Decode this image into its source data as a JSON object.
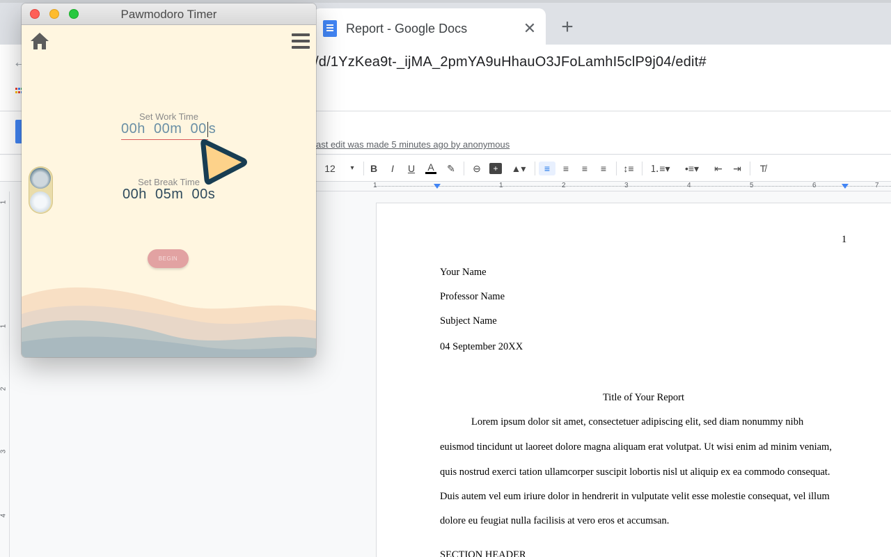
{
  "browser": {
    "tab_title": "Report - Google Docs",
    "tab_close": "✕",
    "new_tab": "+",
    "url": "/d/1YzKea9t-_ijMA_2pmYA9uHhauO3JFoLamhI5clP9j04/edit#",
    "back_arrow": "←"
  },
  "docs": {
    "last_edit": "ast edit was made 5 minutes ago by anonymous",
    "toolbar": {
      "font_size": "12",
      "bold": "B",
      "italic": "I",
      "underline": "U",
      "text_color": "A"
    },
    "ruler_numbers": [
      "1",
      "1",
      "2",
      "3",
      "4",
      "5",
      "6",
      "7"
    ],
    "vruler_numbers": [
      "1",
      "1",
      "2",
      "3",
      "4"
    ],
    "page": {
      "page_number": "1",
      "your_name": "Your Name",
      "professor_name": "Professor Name",
      "subject_name": "Subject Name",
      "date": "04 September 20XX",
      "title": "Title of Your Report",
      "body_lines": [
        "Lorem ipsum dolor sit amet, consectetuer adipiscing elit, sed diam nonummy nibh",
        "euismod tincidunt ut laoreet dolore magna aliquam erat volutpat. Ut wisi enim ad minim veniam,",
        "quis nostrud exerci tation ullamcorper suscipit lobortis nisl ut aliquip ex ea commodo consequat.",
        "Duis autem vel eum iriure dolor in hendrerit in vulputate velit esse molestie consequat, vel illum",
        "dolore eu feugiat nulla facilisis at vero eros et accumsan."
      ],
      "section_header": "SECTION HEADER"
    }
  },
  "pawmodoro": {
    "window_title": "Pawmodoro Timer",
    "work_label": "Set Work Time",
    "work_value_before_cursor": "00h  00m  00",
    "work_value_after_cursor": "s",
    "break_label": "Set Break Time",
    "break_value": "00h  05m  00s",
    "begin_label": "BEGIN",
    "colors": {
      "background": "#fff6e0",
      "begin_button": "#e2a2a2",
      "work_text": "#6a8fa5",
      "break_text": "#2e4a5c"
    }
  },
  "icons": {
    "home": "home-icon",
    "menu": "hamburger-menu-icon",
    "cursor": "play-cursor-icon"
  }
}
